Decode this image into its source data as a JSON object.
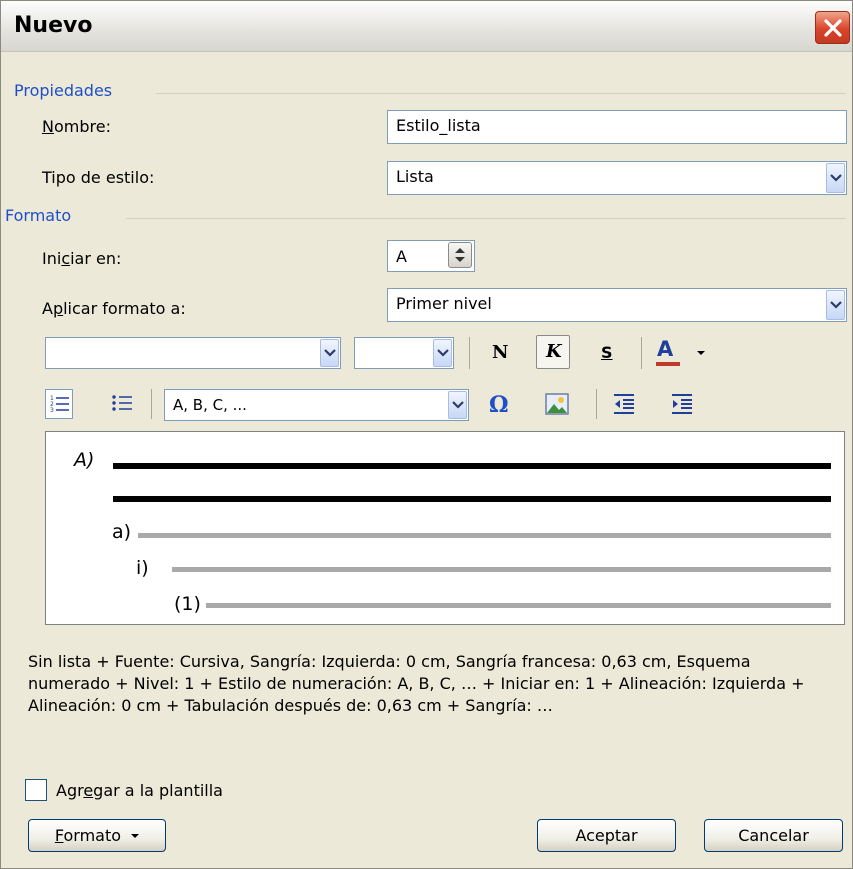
{
  "window": {
    "title": "Nuevo"
  },
  "properties": {
    "group_label": "Propiedades",
    "name_label_u": "N",
    "name_label_rest": "ombre:",
    "name_value": "Estilo_lista",
    "style_type_label": "Tipo de estilo:",
    "style_type_value": "Lista"
  },
  "format": {
    "group_label": "Formato",
    "start_label_a": "Ini",
    "start_label_u": "c",
    "start_label_b": "iar en:",
    "start_value": "A",
    "apply_label_a": "A",
    "apply_label_u": "p",
    "apply_label_b": "licar formato a:",
    "apply_value": "Primer nivel"
  },
  "toolbar1": {
    "font_value": "",
    "size_value": "",
    "bold": "N",
    "italic": "K",
    "underline": "S",
    "font_color": "A",
    "font_color_hex": "#c0392b"
  },
  "toolbar2": {
    "numbering_style_value": "A, B, C, ...",
    "symbol": "Ω"
  },
  "preview": {
    "level1": "A)",
    "level2": "a)",
    "level3": "i)",
    "level4": "(1)"
  },
  "description": "Sin lista + Fuente: Cursiva, Sangría: Izquierda:  0 cm, Sangría francesa:  0,63 cm, Esquema numerado + Nivel: 1 + Estilo de numeración: A, B, C, … + Iniciar en: 1 + Alineación: Izquierda + Alineación:  0 cm + Tabulación después de:  0,63 cm + Sangría: …",
  "template_checkbox": {
    "label_a": "Agr",
    "label_u": "e",
    "label_b": "gar a la plantilla",
    "checked": false
  },
  "buttons": {
    "format_u": "F",
    "format_rest": "ormato",
    "accept": "Aceptar",
    "cancel": "Cancelar"
  },
  "colors": {
    "dialog_bg": "#ece9d8",
    "group_label": "#1f4fc8",
    "close_button": "#d9452a",
    "input_border": "#7f9db9"
  }
}
